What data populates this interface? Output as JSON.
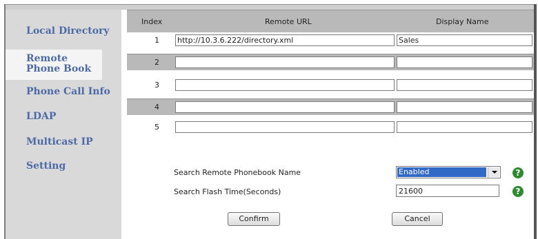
{
  "sidebar": {
    "items": [
      {
        "label": "Local Directory"
      },
      {
        "label": "Remote Phone Book"
      },
      {
        "label": "Phone Call Info"
      },
      {
        "label": "LDAP"
      },
      {
        "label": "Multicast IP"
      },
      {
        "label": "Setting"
      }
    ],
    "active_index": 1
  },
  "table": {
    "headers": {
      "index": "Index",
      "url": "Remote URL",
      "name": "Display Name"
    },
    "rows": [
      {
        "index": "1",
        "url": "http://10.3.6.222/directory.xml",
        "name": "Sales"
      },
      {
        "index": "2",
        "url": "",
        "name": ""
      },
      {
        "index": "3",
        "url": "",
        "name": ""
      },
      {
        "index": "4",
        "url": "",
        "name": ""
      },
      {
        "index": "5",
        "url": "",
        "name": ""
      }
    ]
  },
  "settings": {
    "search_name_label": "Search Remote Phonebook Name",
    "search_name_value": "Enabled",
    "flash_time_label": "Search Flash Time(Seconds)",
    "flash_time_value": "21600",
    "help_glyph": "?"
  },
  "buttons": {
    "confirm": "Confirm",
    "cancel": "Cancel"
  },
  "colors": {
    "sidebar_text": "#4c6aa6",
    "sidebar_bg": "#d9d9d9",
    "header_bg": "#b9b9b9",
    "select_highlight": "#3169c6",
    "help_icon": "#2e8a2e"
  }
}
